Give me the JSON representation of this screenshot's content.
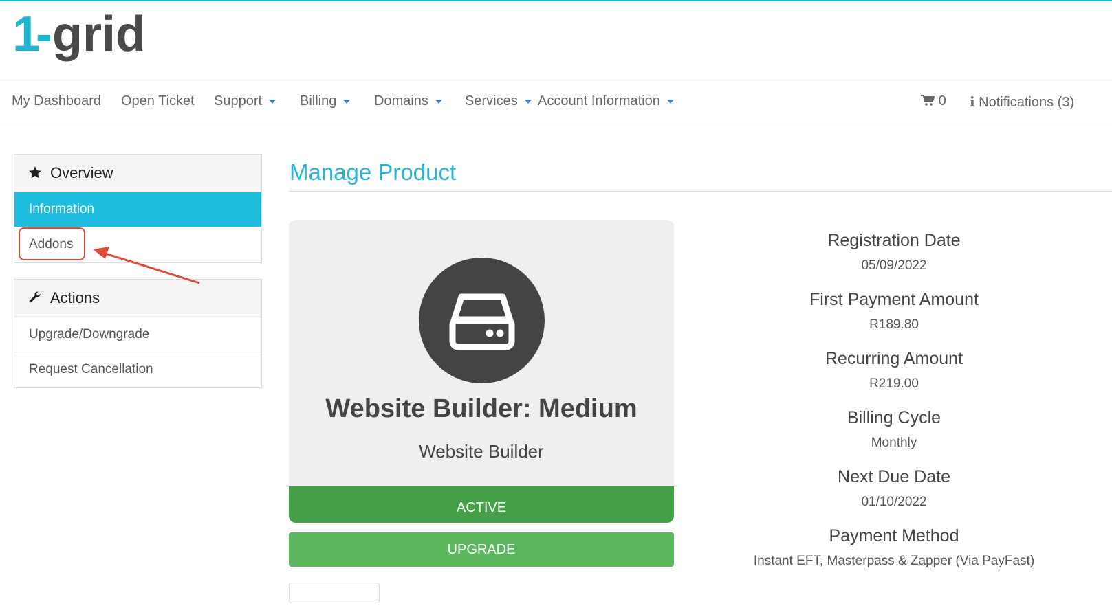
{
  "brand": {
    "logo_text": "1-grid",
    "accent_color": "#29b3d8"
  },
  "nav": {
    "items": [
      {
        "label": "My Dashboard",
        "has_dropdown": false
      },
      {
        "label": "Open Ticket",
        "has_dropdown": false
      },
      {
        "label": "Support",
        "has_dropdown": true
      },
      {
        "label": "Billing",
        "has_dropdown": true
      },
      {
        "label": "Domains",
        "has_dropdown": true
      },
      {
        "label": "Services",
        "has_dropdown": true
      },
      {
        "label": "Account Information",
        "has_dropdown": true
      }
    ],
    "cart_count": "0",
    "notifications_label": "Notifications (3)"
  },
  "sidebar": {
    "overview": {
      "heading": "Overview",
      "icon": "star-icon",
      "items": [
        {
          "label": "Information",
          "active": true
        },
        {
          "label": "Addons",
          "active": false,
          "highlighted": true
        }
      ]
    },
    "actions": {
      "heading": "Actions",
      "icon": "wrench-icon",
      "items": [
        {
          "label": "Upgrade/Downgrade"
        },
        {
          "label": "Request Cancellation"
        }
      ]
    }
  },
  "main": {
    "title": "Manage Product",
    "product": {
      "icon": "hard-drive-icon",
      "name": "Website Builder: Medium",
      "group": "Website Builder",
      "status": "ACTIVE",
      "status_color": "#43a047",
      "upgrade_label": "UPGRADE",
      "upgrade_color": "#5cb85c"
    },
    "details": [
      {
        "label": "Registration Date",
        "value": "05/09/2022"
      },
      {
        "label": "First Payment Amount",
        "value": "R189.80"
      },
      {
        "label": "Recurring Amount",
        "value": "R219.00"
      },
      {
        "label": "Billing Cycle",
        "value": "Monthly"
      },
      {
        "label": "Next Due Date",
        "value": "01/10/2022"
      },
      {
        "label": "Payment Method",
        "value": "Instant EFT, Masterpass & Zapper (Via PayFast)"
      }
    ]
  },
  "annotation": {
    "color": "#e04a3a"
  }
}
